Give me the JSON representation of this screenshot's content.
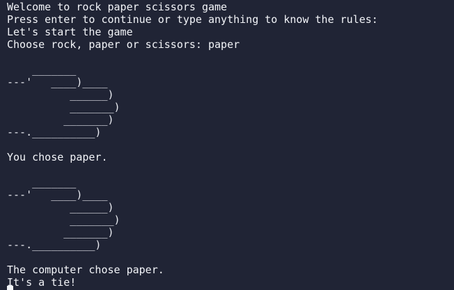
{
  "terminal": {
    "lines": [
      "Welcome to rock paper scissors game",
      "Press enter to continue or type anything to know the rules:",
      "Let's start the game",
      "Choose rock, paper or scissors: paper",
      "",
      "    _______",
      "---'   ____)____",
      "          ______)",
      "          _______)",
      "         _______)",
      "---.__________)",
      "",
      "You chose paper.",
      "",
      "    _______",
      "---'   ____)____",
      "          ______)",
      "          _______)",
      "         _______)",
      "---.__________)",
      "",
      "The computer chose paper.",
      "It's a tie!"
    ]
  }
}
